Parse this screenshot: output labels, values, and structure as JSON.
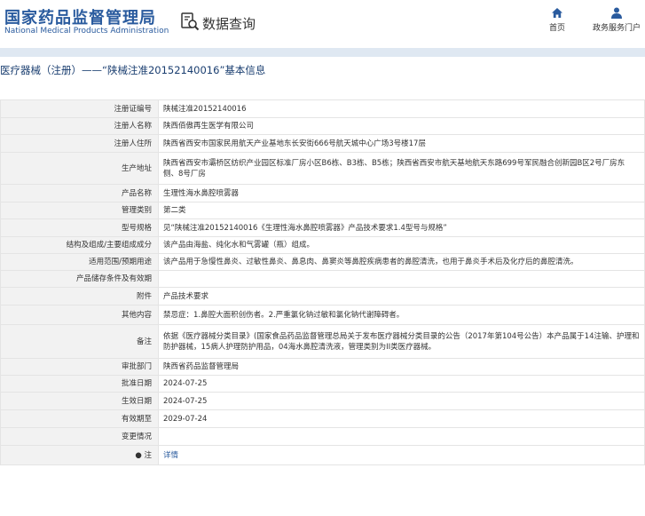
{
  "header": {
    "logo_cn": "国家药品监督管理局",
    "logo_en": "National Medical Products Administration",
    "query_label": "数据查询",
    "nav": {
      "home": "首页",
      "gov_service": "政务服务门户"
    }
  },
  "page_title": "医疗器械（注册）——“陕械注准20152140016”基本信息",
  "rows": [
    {
      "label": "注册证编号",
      "value": "陕械注准20152140016"
    },
    {
      "label": "注册人名称",
      "value": "陕西佰傲再生医学有限公司"
    },
    {
      "label": "注册人住所",
      "value": "陕西省西安市国家民用航天产业基地东长安街666号航天城中心广场3号楼17层"
    },
    {
      "label": "生产地址",
      "value": "陕西省西安市灞桥区纺织产业园区标准厂房小区B6栋、B3栋、B5栋；陕西省西安市航天基地航天东路699号军民融合创新园B区2号厂房东侧、8号厂房"
    },
    {
      "label": "产品名称",
      "value": "生理性海水鼻腔喷雾器"
    },
    {
      "label": "管理类别",
      "value": "第二类"
    },
    {
      "label": "型号规格",
      "value": "见“陕械注准20152140016《生理性海水鼻腔喷雾器》产品技术要求1.4型号与规格”"
    },
    {
      "label": "结构及组成/主要组成成分",
      "value": "该产品由海盐、纯化水和气雾罐（瓶）组成。"
    },
    {
      "label": "适用范围/预期用途",
      "value": "该产品用于急慢性鼻炎、过敏性鼻炎、鼻息肉、鼻窦炎等鼻腔疾病患者的鼻腔清洗，也用于鼻炎手术后及化疗后的鼻腔清洗。"
    },
    {
      "label": "产品储存条件及有效期",
      "value": ""
    },
    {
      "label": "附件",
      "value": "产品技术要求"
    },
    {
      "label": "其他内容",
      "value": "禁忌症：1.鼻腔大面积创伤者。2.严重氯化钠过敏和氯化钠代谢障碍者。"
    },
    {
      "label": "备注",
      "value": "依据《医疗器械分类目录》(国家食品药品监督管理总局关于发布医疗器械分类目录的公告（2017年第104号公告）本产品属于14注输、护理和防护器械，15病人护理防护用品，04海水鼻腔清洗液，管理类别为II类医疗器械。"
    },
    {
      "label": "审批部门",
      "value": "陕西省药品监督管理局"
    },
    {
      "label": "批准日期",
      "value": "2024-07-25"
    },
    {
      "label": "生效日期",
      "value": "2024-07-25"
    },
    {
      "label": "有效期至",
      "value": "2029-07-24"
    },
    {
      "label": "变更情况",
      "value": ""
    }
  ],
  "note_row": {
    "label": "注",
    "link": "详情"
  },
  "colors": {
    "brand_blue": "#2a5b9e",
    "label_bg": "#f2f2f2"
  }
}
